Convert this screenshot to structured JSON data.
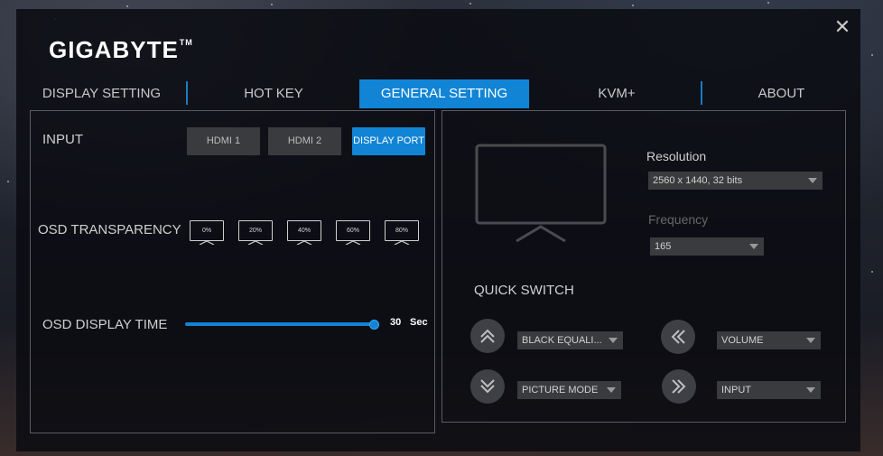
{
  "app": {
    "logo_text": "GIGABYTE",
    "trademark": "TM",
    "close_glyph": "✕"
  },
  "tabs": [
    {
      "label": "DISPLAY SETTING",
      "active": false
    },
    {
      "label": "HOT KEY",
      "active": false
    },
    {
      "label": "GENERAL SETTING",
      "active": true
    },
    {
      "label": "KVM+",
      "active": false
    },
    {
      "label": "ABOUT",
      "active": false
    }
  ],
  "input": {
    "label": "INPUT",
    "options": [
      "HDMI 1",
      "HDMI 2",
      "DISPLAY PORT"
    ],
    "selected": "DISPLAY PORT"
  },
  "osd_transparency": {
    "label": "OSD TRANSPARENCY",
    "options": [
      "0%",
      "20%",
      "40%",
      "60%",
      "80%"
    ]
  },
  "osd_display_time": {
    "label": "OSD DISPLAY TIME",
    "value": "30",
    "unit": "Sec",
    "slider_fraction": 1.0
  },
  "display": {
    "resolution_label": "Resolution",
    "resolution_value": "2560 x 1440, 32 bits",
    "frequency_label": "Frequency",
    "frequency_value": "165"
  },
  "quick_switch": {
    "label": "QUICK SWITCH",
    "up_icon": "double-chevron-up-icon",
    "down_icon": "double-chevron-down-icon",
    "left_icon": "double-chevron-left-icon",
    "right_icon": "double-chevron-right-icon",
    "up_value": "BLACK EQUALI...",
    "down_value": "PICTURE MODE",
    "left_value": "VOLUME",
    "right_value": "INPUT"
  },
  "colors": {
    "accent": "#1184d6",
    "panel_border": "#5a5c62",
    "button_bg": "#3a3b3e"
  }
}
